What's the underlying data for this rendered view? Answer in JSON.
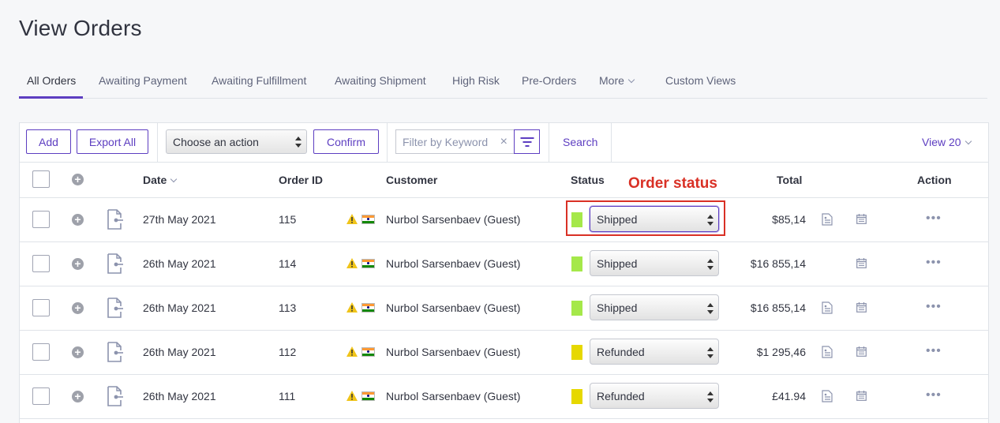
{
  "page": {
    "title": "View Orders"
  },
  "tabs": [
    {
      "label": "All Orders",
      "active": true
    },
    {
      "label": "Awaiting Payment"
    },
    {
      "label": "Awaiting Fulfillment"
    },
    {
      "label": "Awaiting Shipment"
    },
    {
      "label": "High Risk"
    },
    {
      "label": "Pre-Orders"
    },
    {
      "label": "More"
    },
    {
      "label": "Custom Views"
    }
  ],
  "toolbar": {
    "add_label": "Add",
    "export_label": "Export All",
    "action_select": "Choose an action",
    "confirm_label": "Confirm",
    "filter_placeholder": "Filter by Keyword",
    "search_label": "Search",
    "view_label": "View 20"
  },
  "columns": {
    "date": "Date",
    "order_id": "Order ID",
    "customer": "Customer",
    "status": "Status",
    "total": "Total",
    "action": "Action"
  },
  "annotation": {
    "label": "Order status",
    "color": "#d93025"
  },
  "status_colors": {
    "Shipped": "#a5e84a",
    "Refunded": "#e6d800"
  },
  "orders": [
    {
      "date": "27th May 2021",
      "id": "115",
      "customer": "Nurbol Sarsenbaev (Guest)",
      "status": "Shipped",
      "total": "$85,14",
      "print_icon": true
    },
    {
      "date": "26th May 2021",
      "id": "114",
      "customer": "Nurbol Sarsenbaev (Guest)",
      "status": "Shipped",
      "total": "$16 855,14",
      "print_icon": false
    },
    {
      "date": "26th May 2021",
      "id": "113",
      "customer": "Nurbol Sarsenbaev (Guest)",
      "status": "Shipped",
      "total": "$16 855,14",
      "print_icon": true
    },
    {
      "date": "26th May 2021",
      "id": "112",
      "customer": "Nurbol Sarsenbaev (Guest)",
      "status": "Refunded",
      "total": "$1 295,46",
      "print_icon": true
    },
    {
      "date": "26th May 2021",
      "id": "111",
      "customer": "Nurbol Sarsenbaev (Guest)",
      "status": "Refunded",
      "total": "£41.94",
      "print_icon": true
    }
  ]
}
